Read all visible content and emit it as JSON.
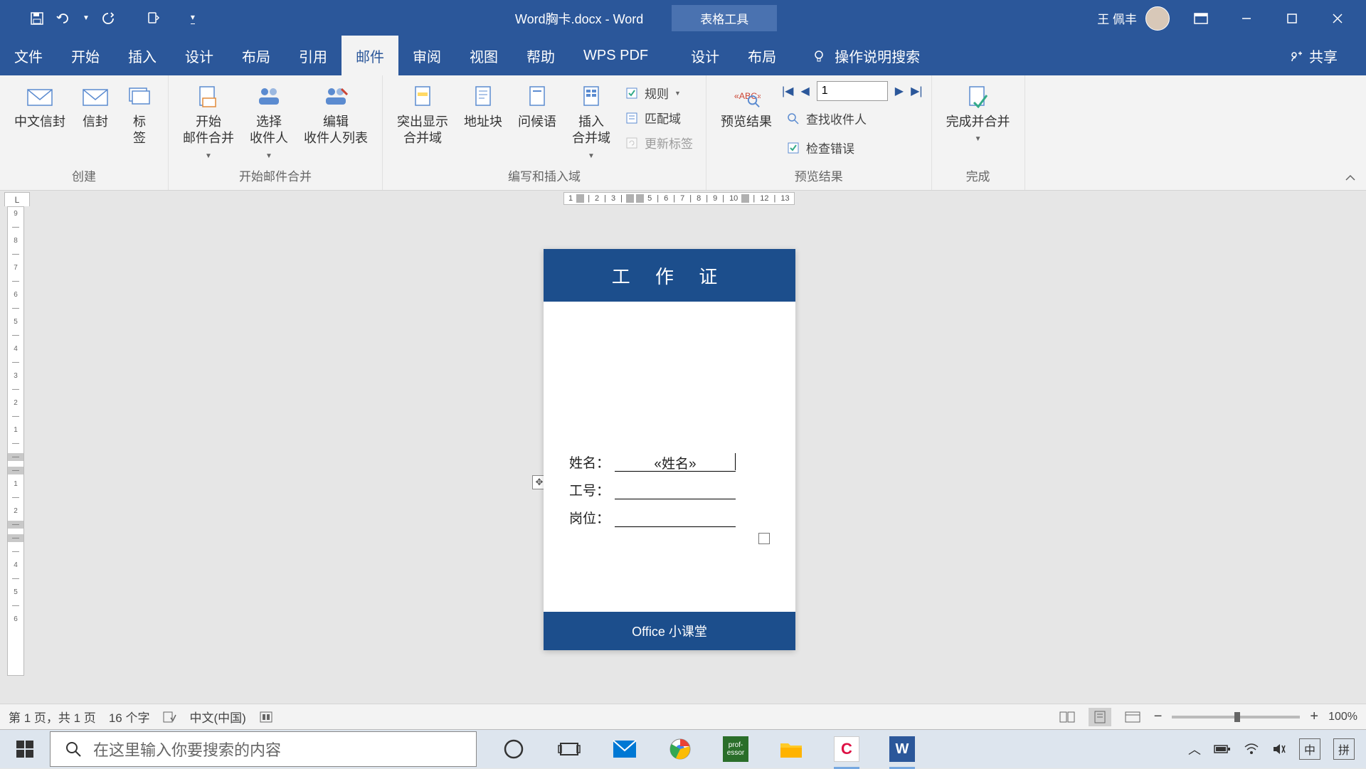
{
  "titlebar": {
    "doc_title": "Word胸卡.docx  -  Word",
    "tools_label": "表格工具",
    "user_name": "王 佩丰"
  },
  "tabs": {
    "file": "文件",
    "home": "开始",
    "insert": "插入",
    "design": "设计",
    "layout": "布局",
    "references": "引用",
    "mailings": "邮件",
    "review": "审阅",
    "view": "视图",
    "help": "帮助",
    "wpspdf": "WPS PDF",
    "table_design": "设计",
    "table_layout": "布局",
    "tell_me": "操作说明搜索",
    "share": "共享"
  },
  "ribbon": {
    "create": {
      "label": "创建",
      "cn_env": "中文信封",
      "env": "信封",
      "labels_btn": "标\n签"
    },
    "start": {
      "label": "开始邮件合并",
      "start_merge": "开始\n邮件合并",
      "select_recip": "选择\n收件人",
      "edit_recip": "编辑\n收件人列表"
    },
    "write": {
      "label": "编写和插入域",
      "highlight": "突出显示\n合并域",
      "address": "地址块",
      "greeting": "问候语",
      "insert_field": "插入\n合并域",
      "rules": "规则",
      "match": "匹配域",
      "update": "更新标签"
    },
    "preview": {
      "label": "预览结果",
      "preview_btn": "预览结果",
      "find": "查找收件人",
      "check": "检查错误",
      "record": "1"
    },
    "finish": {
      "label": "完成",
      "finish_btn": "完成并合并"
    }
  },
  "document": {
    "card_title": "工 作 证",
    "name_label": "姓名：",
    "name_value": "«姓名»",
    "id_label": "工号：",
    "post_label": "岗位：",
    "footer": "Office 小课堂"
  },
  "statusbar": {
    "page": "第 1 页，共 1 页",
    "words": "16 个字",
    "lang": "中文(中国)",
    "zoom": "100%"
  },
  "taskbar": {
    "search_placeholder": "在这里输入你要搜索的内容",
    "ime1": "中",
    "ime2": "拼"
  },
  "ruler": {
    "h": [
      "1",
      "",
      "|",
      "2",
      "|",
      "3",
      "|",
      "",
      "",
      "5",
      "|",
      "6",
      "|",
      "7",
      "|",
      "8",
      "|",
      "9",
      "|",
      "10",
      "",
      "",
      "|",
      "12",
      "|",
      "13"
    ]
  }
}
